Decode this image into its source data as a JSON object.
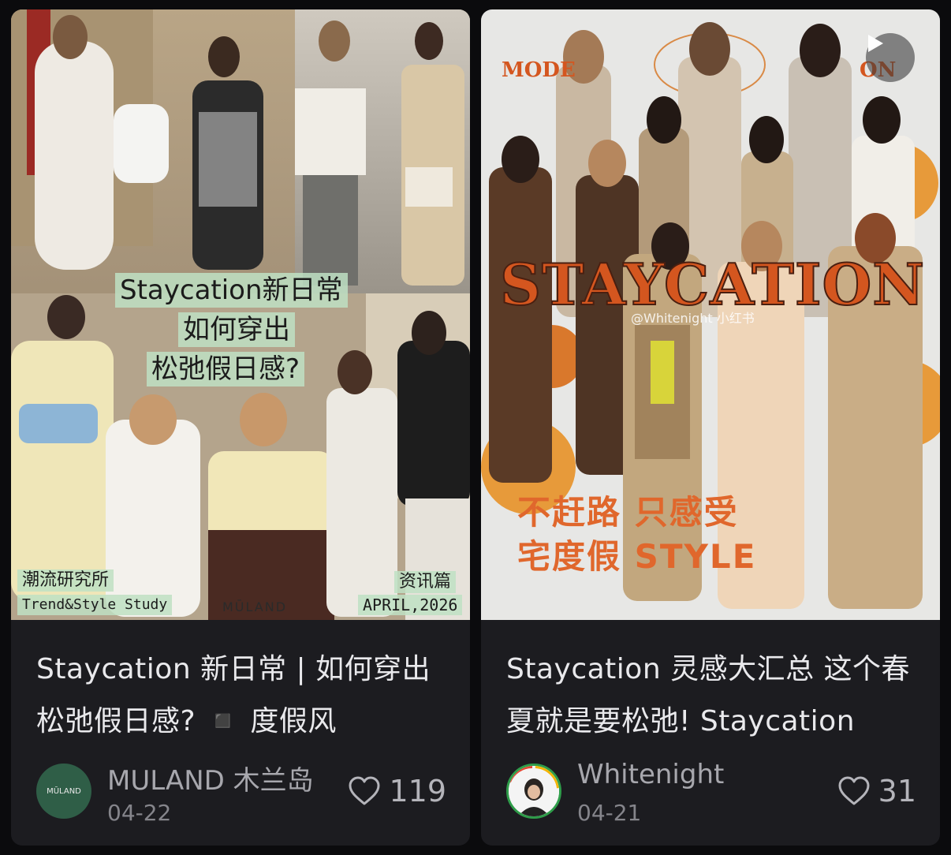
{
  "cards": [
    {
      "cover": {
        "headline": [
          "Staycation新日常",
          "如何穿出",
          "松弛假日感?"
        ],
        "corner_left_top": "潮流研究所",
        "corner_left_bottom": "Trend&Style Study",
        "corner_right_top": "资讯篇",
        "corner_right_bottom": "APRIL,2026",
        "watermark": "MŪLAND"
      },
      "title": "Staycation 新日常 | 如何穿出松弛假日感? ◾️ 度假风",
      "author": "MULAND 木兰岛",
      "avatar_text": "MŪLAND",
      "avatar_color": "#2f5e47",
      "date": "04-22",
      "likes": "119"
    },
    {
      "cover": {
        "mode_left": "MODE",
        "mode_right": "ON",
        "big_title": "STAYCATION",
        "line1": "不赶路 只感受",
        "line2": "宅度假 STYLE",
        "watermark": "@Whitenight 小红书",
        "play_icon": "play-icon"
      },
      "title": "Staycation 灵感大汇总 这个春夏就是要松弛! Staycation",
      "author": "Whitenight",
      "date": "04-21",
      "likes": "31"
    }
  ],
  "colors": {
    "background": "#0b0b0d",
    "card": "#1c1c20",
    "title_orange": "#d4561f"
  }
}
